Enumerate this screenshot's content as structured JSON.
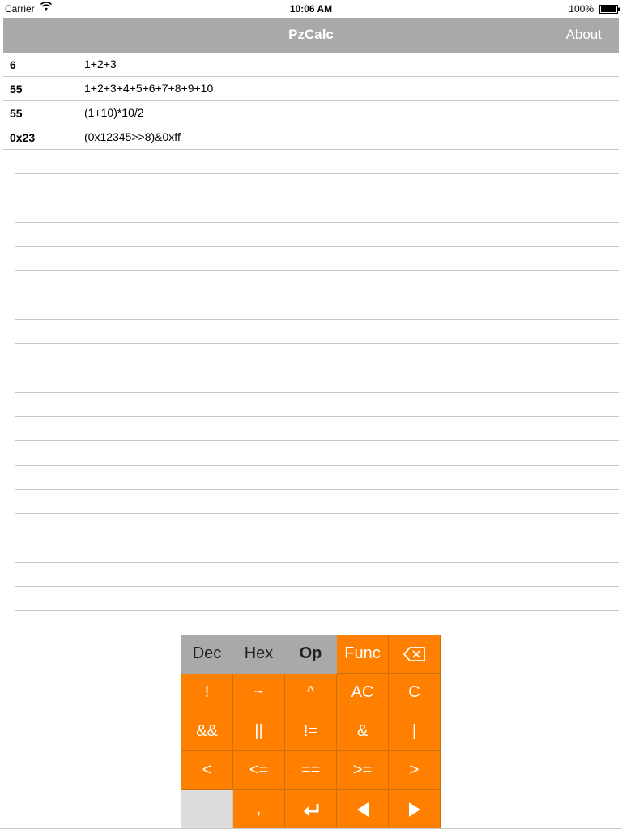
{
  "status_bar": {
    "carrier": "Carrier",
    "time": "10:06 AM",
    "battery": "100%"
  },
  "nav": {
    "title": "PzCalc",
    "about_label": "About"
  },
  "history": [
    {
      "result": "6",
      "expression": "1+2+3"
    },
    {
      "result": "55",
      "expression": "1+2+3+4+5+6+7+8+9+10"
    },
    {
      "result": "55",
      "expression": "(1+10)*10/2"
    },
    {
      "result": "0x23",
      "expression": "(0x12345>>8)&0xff"
    }
  ],
  "keypad": {
    "mode_dec": "Dec",
    "mode_hex": "Hex",
    "mode_op": "Op",
    "func": "Func",
    "backspace_icon": "backspace-icon",
    "keys": {
      "not": "!",
      "tilde": "~",
      "caret": "^",
      "ac": "AC",
      "c": "C",
      "logical_and": "&&",
      "logical_or": "||",
      "not_equal": "!=",
      "bitwise_and": "&",
      "bitwise_or": "|",
      "less": "<",
      "less_equal": "<=",
      "equal": "==",
      "greater_equal": ">=",
      "greater": ">",
      "comma": ","
    },
    "enter_icon": "return-icon",
    "left_icon": "left-arrow-icon",
    "right_icon": "right-arrow-icon",
    "accent_color": "#ff8000",
    "mode_color": "#a9a9a9"
  }
}
